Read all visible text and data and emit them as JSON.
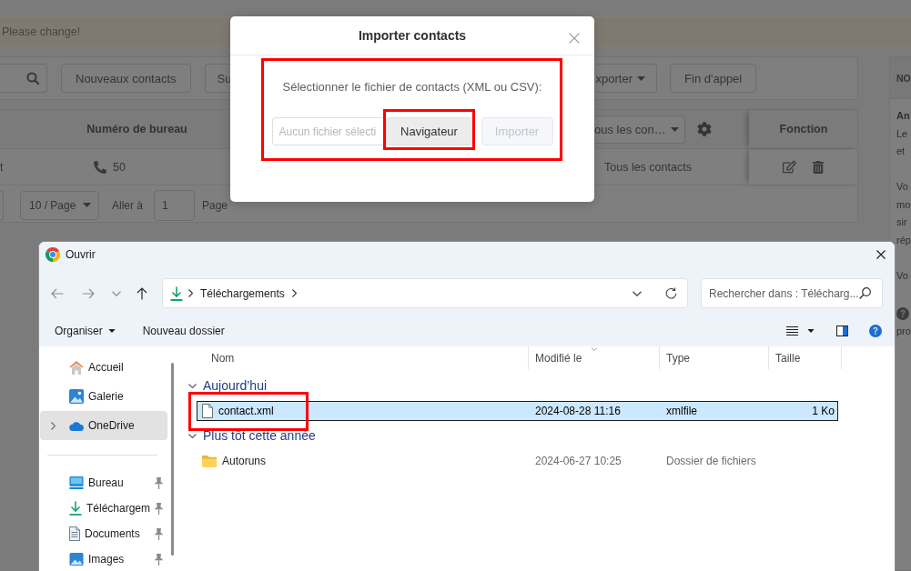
{
  "banner": {
    "text": "Please change!"
  },
  "toolbar": {
    "left": [
      {
        "label": "Nouveaux contacts",
        "kind": "button"
      },
      {
        "label": "Su",
        "kind": "button"
      }
    ],
    "right": [
      {
        "label": "xporter",
        "kind": "dropdown"
      },
      {
        "label": "Fin d'appel",
        "kind": "button"
      }
    ]
  },
  "table": {
    "header": {
      "office_number": "Numéro de bureau",
      "group_filter": "ous les con…",
      "actions": "Fonction"
    },
    "rows": [
      {
        "column_1": "t",
        "office_number": "50",
        "group": "Tous les contacts"
      }
    ],
    "pagination": {
      "page_size": "10 / Page",
      "goto_label": "Aller à",
      "goto_value": "1",
      "page_label": "Page"
    }
  },
  "side_panel": {
    "title": "NO",
    "blocks": [
      {
        "kind": "heading",
        "lines": [
          "An"
        ]
      },
      {
        "kind": "text",
        "lines": [
          "Le",
          "et"
        ]
      },
      {
        "kind": "text",
        "lines": [
          "Vo",
          "mo",
          "sir",
          "rép"
        ]
      },
      {
        "kind": "text",
        "lines": [
          "Vo"
        ]
      },
      {
        "kind": "help",
        "lines": [
          "pro"
        ]
      }
    ]
  },
  "import_dialog": {
    "title": "Importer contacts",
    "prompt": "Sélectionner le fichier de contacts (XML ou CSV):",
    "file_field": {
      "placeholder": "Aucun fichier sélecti"
    },
    "browse_button": {
      "label": "Navigateur",
      "highlighted": true
    },
    "import_button": {
      "label": "Importer",
      "disabled": true
    },
    "highlighted": true
  },
  "file_dialog": {
    "title": "Ouvrir",
    "address": [
      "Téléchargements"
    ],
    "search": {
      "placeholder": "Rechercher dans : Télécharg..."
    },
    "commands": {
      "organize": "Organiser",
      "new_folder": "Nouveau dossier"
    },
    "nav": [
      {
        "items": [
          {
            "label": "Accueil",
            "kind": "home",
            "selected": false,
            "expander": false,
            "pinned": false
          },
          {
            "label": "Galerie",
            "kind": "gallery",
            "selected": false,
            "expander": false,
            "pinned": false
          },
          {
            "label": "OneDrive",
            "kind": "cloud",
            "selected": true,
            "expander": true,
            "pinned": false
          }
        ]
      },
      {
        "items": [
          {
            "label": "Bureau",
            "kind": "desktop",
            "selected": false,
            "expander": false,
            "pinned": true
          },
          {
            "label": "Téléchargem",
            "kind": "downloads",
            "selected": false,
            "expander": false,
            "pinned": true
          },
          {
            "label": "Documents",
            "kind": "documents",
            "selected": false,
            "expander": false,
            "pinned": true
          },
          {
            "label": "Images",
            "kind": "pictures",
            "selected": false,
            "expander": false,
            "pinned": true
          }
        ]
      }
    ],
    "columns": [
      {
        "label": "Nom",
        "sorted": false
      },
      {
        "label": "Modifié le",
        "sorted": true
      },
      {
        "label": "Type",
        "sorted": false
      },
      {
        "label": "Taille",
        "sorted": false
      }
    ],
    "groups": [
      {
        "label": "Aujourd’hui",
        "expanded": true,
        "files": [
          {
            "name": "contact.xml",
            "kind": "file",
            "modified": "2024-08-28 11:16",
            "type": "xmlfile",
            "size": "1 Ko",
            "selected": true,
            "highlighted": true
          }
        ]
      },
      {
        "label": "Plus tôt cette année",
        "expanded": true,
        "files": [
          {
            "name": "Autoruns",
            "kind": "folder",
            "modified": "2024-06-27 10:25",
            "type": "Dossier de fichiers",
            "selected": false,
            "highlighted": false
          }
        ]
      }
    ]
  }
}
